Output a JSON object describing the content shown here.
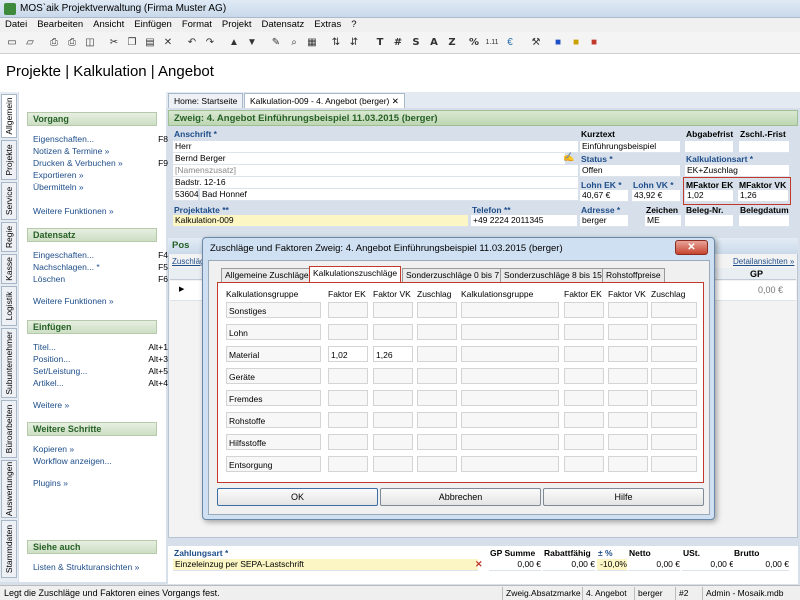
{
  "window": {
    "title": "MOS`aik Projektverwaltung (Firma Muster AG)"
  },
  "menu": [
    "Datei",
    "Bearbeiten",
    "Ansicht",
    "Einfügen",
    "Format",
    "Projekt",
    "Datensatz",
    "Extras",
    "?"
  ],
  "toolbar_text_buttons": [
    "T",
    "#",
    "S",
    "A",
    "Z",
    "%",
    "1.11"
  ],
  "page_title": "Projekte | Kalkulation | Angebot",
  "vertical_tabs": [
    "Allgemein",
    "Projekte",
    "Service",
    "Regie",
    "Kasse",
    "Logistik",
    "Subunternehmer",
    "Büroarbeiten",
    "Auswertungen",
    "Stammdaten"
  ],
  "nav": {
    "vorgang": {
      "title": "Vorgang",
      "items": [
        {
          "label": "Eigenschaften...",
          "sc": "F8"
        },
        {
          "label": "Notizen & Termine »",
          "sc": ""
        },
        {
          "label": "Drucken & Verbuchen »",
          "sc": "F9"
        },
        {
          "label": "Exportieren »",
          "sc": ""
        },
        {
          "label": "Übermitteln »",
          "sc": ""
        }
      ],
      "more": "Weitere Funktionen »"
    },
    "datensatz": {
      "title": "Datensatz",
      "items": [
        {
          "label": "Eingeschaften...",
          "sc": "F4"
        },
        {
          "label": "Nachschlagen... *",
          "sc": "F5"
        },
        {
          "label": "Löschen",
          "sc": "F6"
        }
      ],
      "more": "Weitere Funktionen »"
    },
    "einfuegen": {
      "title": "Einfügen",
      "items": [
        {
          "label": "Titel...",
          "sc": "Alt+1"
        },
        {
          "label": "Position...",
          "sc": "Alt+3"
        },
        {
          "label": "Set/Leistung...",
          "sc": "Alt+5"
        },
        {
          "label": "Artikel...",
          "sc": "Alt+4"
        }
      ],
      "more": "Weitere »"
    },
    "weitere": {
      "title": "Weitere Schritte",
      "items": [
        {
          "label": "Kopieren »",
          "sc": ""
        },
        {
          "label": "Workflow anzeigen...",
          "sc": ""
        },
        {
          "label": "Plugins »",
          "sc": ""
        }
      ]
    },
    "siehe": {
      "title": "Siehe auch",
      "items": [
        {
          "label": "Listen & Strukturansichten »",
          "sc": ""
        }
      ]
    }
  },
  "doc_tabs": {
    "home": "Home: Startseite",
    "active": "Kalkulation-009 - 4. Angebot (berger)"
  },
  "zweig_title": "Zweig: 4. Angebot Einführungsbeispiel 11.03.2015 (berger)",
  "anschrift": {
    "label": "Anschrift *",
    "lines": [
      "Herr",
      "Bernd Berger",
      "[Namenszusatz]",
      "Badstr. 12-16"
    ],
    "plz": "53604",
    "ort": "Bad Honnef"
  },
  "projektakte": {
    "label": "Projektakte **",
    "value": "Kalkulation-009"
  },
  "telefon": {
    "label": "Telefon **",
    "value": "+49 2224 2011345"
  },
  "kurztext": {
    "label": "Kurztext",
    "value": "Einführungsbeispiel"
  },
  "abgabefrist": {
    "label": "Abgabefrist"
  },
  "zschl_frist": {
    "label": "Zschl.-Frist"
  },
  "status": {
    "label": "Status *",
    "value": "Offen"
  },
  "kalkulationsart": {
    "label": "Kalkulationsart *",
    "value": "EK+Zuschlag"
  },
  "lohn_ek": {
    "label": "Lohn EK *",
    "value": "40,67 €"
  },
  "lohn_vk": {
    "label": "Lohn VK *",
    "value": "43,92 €"
  },
  "mfaktor_ek": {
    "label": "MFaktor EK",
    "value": "1,02"
  },
  "mfaktor_vk": {
    "label": "MFaktor VK",
    "value": "1,26"
  },
  "adresse": {
    "label": "Adresse *",
    "value": "berger"
  },
  "zeichen": {
    "label": "Zeichen",
    "value": "ME"
  },
  "beleg_nr": {
    "label": "Beleg-Nr."
  },
  "belegdatum": {
    "label": "Belegdatum"
  },
  "lower": {
    "header": "Pos",
    "zuschlag": "Zuschläg",
    "detail": "Detailansichten »",
    "gp": "GP",
    "gp_value": "0,00 €"
  },
  "bottom": {
    "zahlungsart_label": "Zahlungsart *",
    "zahlungsart_value": "Einzeleinzug per SEPA-Lastschrift",
    "cols": [
      "GP Summe",
      "Rabattfähig",
      "± %",
      "Netto",
      "USt.",
      "Brutto"
    ],
    "percent": "-10,0%",
    "values": [
      "0,00 €",
      "0,00 €",
      "0,00 €",
      "0,00 €",
      "0,00 €"
    ]
  },
  "status_bar": {
    "message": "Legt die Zuschläge und Faktoren eines Vorgangs fest.",
    "cells": [
      "Zweig.Absatzmarke",
      "4. Angebot",
      "berger",
      "#2",
      "Admin - Mosaik.mdb"
    ]
  },
  "dialog": {
    "title": "Zuschläge und Faktoren Zweig: 4. Angebot Einführungsbeispiel 11.03.2015 (berger)",
    "tabs": [
      "Allgemeine Zuschläge",
      "Kalkulationszuschläge",
      "Sonderzuschläge 0 bis 7",
      "Sonderzuschläge 8 bis 15",
      "Rohstoffpreise"
    ],
    "headers": [
      "Kalkulationsgruppe",
      "Faktor EK",
      "Faktor VK",
      "Zuschlag",
      "Kalkulationsgruppe",
      "Faktor EK",
      "Faktor VK",
      "Zuschlag"
    ],
    "rows": [
      {
        "group": "Sonstiges",
        "ek": "",
        "vk": ""
      },
      {
        "group": "Lohn",
        "ek": "",
        "vk": ""
      },
      {
        "group": "Material",
        "ek": "1,02",
        "vk": "1,26"
      },
      {
        "group": "Geräte",
        "ek": "",
        "vk": ""
      },
      {
        "group": "Fremdes",
        "ek": "",
        "vk": ""
      },
      {
        "group": "Rohstoffe",
        "ek": "",
        "vk": ""
      },
      {
        "group": "Hilfsstoffe",
        "ek": "",
        "vk": ""
      },
      {
        "group": "Entsorgung",
        "ek": "",
        "vk": ""
      }
    ],
    "buttons": {
      "ok": "OK",
      "cancel": "Abbrechen",
      "help": "Hilfe"
    }
  }
}
